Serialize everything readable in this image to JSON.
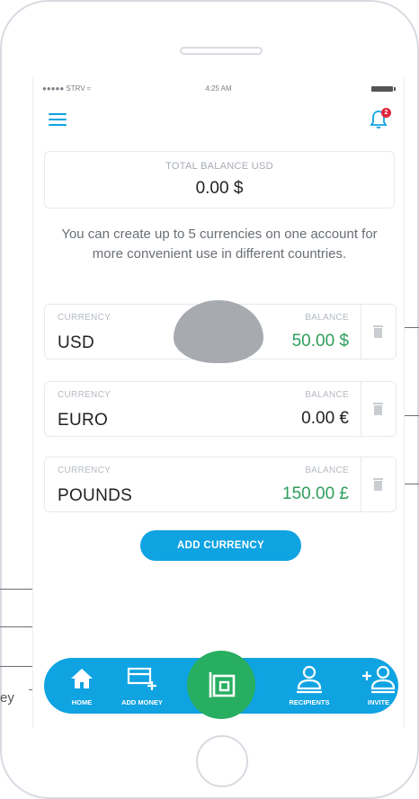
{
  "status": {
    "carrier": "●●●●● STRV ≈",
    "time": "4:25 AM"
  },
  "header": {
    "notifications_count": "2"
  },
  "balance": {
    "label": "TOTAL BALANCE USD",
    "value": "0.00 $"
  },
  "info_text": "You can create up to 5 currencies on one account  for more convenient use in different countries.",
  "currencies": [
    {
      "currency_label": "CURRENCY",
      "name": "USD",
      "balance_label": "BALANCE",
      "balance": "50.00 $",
      "balance_color": "#2e9e5d"
    },
    {
      "currency_label": "CURRENCY",
      "name": "EURO",
      "balance_label": "BALANCE",
      "balance": "0.00 €",
      "balance_color": "#222222"
    },
    {
      "currency_label": "CURRENCY",
      "name": "POUNDS",
      "balance_label": "BALANCE",
      "balance": "150.00 £",
      "balance_color": "#2e9e5d"
    }
  ],
  "add_currency_label": "ADD CURRENCY",
  "tabs": [
    {
      "label": "HOME",
      "icon": "home-icon"
    },
    {
      "label": "ADD MONEY",
      "icon": "add-money-icon"
    },
    {
      "label": "RECIPIENTS",
      "icon": "recipients-icon"
    },
    {
      "label": "INVITE",
      "icon": "invite-icon"
    }
  ],
  "center_action_icon": "wallet-icon",
  "annotation_fragment": "ey",
  "colors": {
    "accent": "#0fa3e2",
    "positive": "#2e9e5d",
    "wallet": "#27ae60",
    "badge": "#e0263b"
  }
}
